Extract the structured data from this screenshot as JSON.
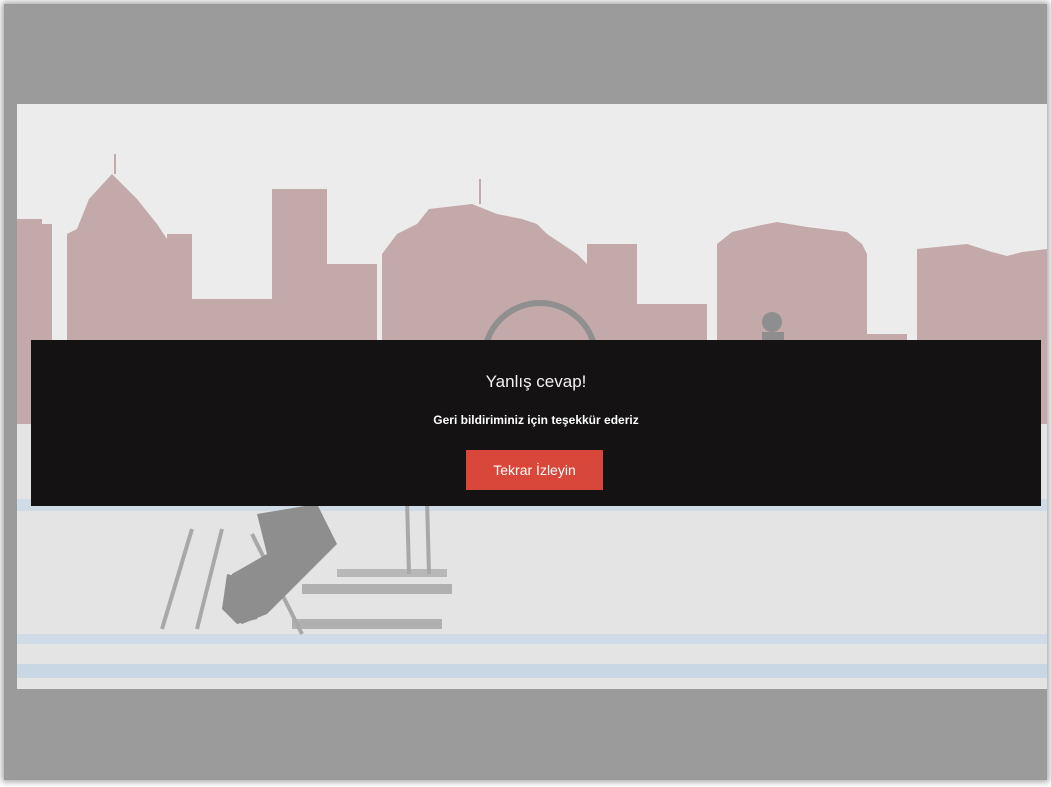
{
  "overlay": {
    "title": "Yanlış cevap!",
    "subtitle": "Geri bildiriminiz için teşekkür ederiz",
    "replay_label": "Tekrar İzleyin"
  },
  "colors": {
    "outer_frame": "#9b9b9b",
    "overlay_background": "#141212",
    "replay_button": "#d9473a",
    "skyline": "#c4a9aa"
  }
}
